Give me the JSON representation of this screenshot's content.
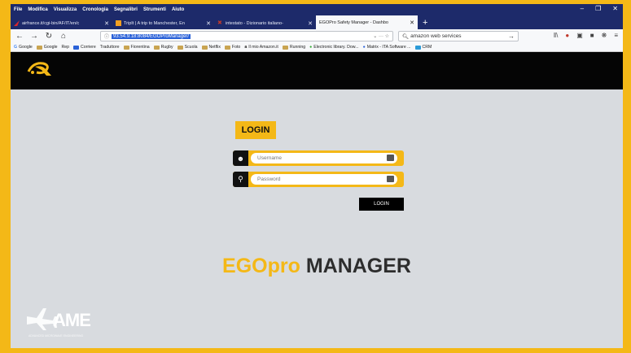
{
  "browser": {
    "menu": [
      "File",
      "Modifica",
      "Visualizza",
      "Cronologia",
      "Segnalibri",
      "Strumenti",
      "Aiuto"
    ],
    "tabs": [
      {
        "label": "airfrance.it/cgi-bin/AF/IT/en/c",
        "favicon_color": "#d9262e",
        "active": false
      },
      {
        "label": "TripIt | A trip to Manchester, En",
        "favicon_color": "#f4a021",
        "active": false
      },
      {
        "label": "intestato - Dizionario italiano-",
        "favicon_color": "#c0392b",
        "active": false
      },
      {
        "label": "EGOPro Safety Manager - Dashbo",
        "favicon_color": "#ffffff",
        "active": true
      }
    ],
    "url": "93.54.9.18:8084/EGOProManager/",
    "search_value": "amazon web services",
    "bookmarks": [
      "Google",
      "Google",
      "Rep",
      "Corriere",
      "Traduttore",
      "Fiorentina",
      "Rugby",
      "Scuola",
      "Netflix",
      "Foto",
      "Il mio Amazon.it",
      "Running",
      "Electronic library. Dow...",
      "Matrix - ITA Software ...",
      "CRM"
    ]
  },
  "login": {
    "title": "LOGIN",
    "username_placeholder": "Username",
    "password_placeholder": "Password",
    "button_label": "LOGIN"
  },
  "brand": {
    "part1": "EGOpro",
    "part2": "MANAGER"
  },
  "footer_logo": {
    "text": "AME",
    "tagline": "ADVANCED MICROWAVE ENGINEERING"
  },
  "colors": {
    "accent": "#f4b817",
    "dark": "#050505",
    "background": "#d8dbdf",
    "browser_chrome": "#1d2a6a"
  }
}
